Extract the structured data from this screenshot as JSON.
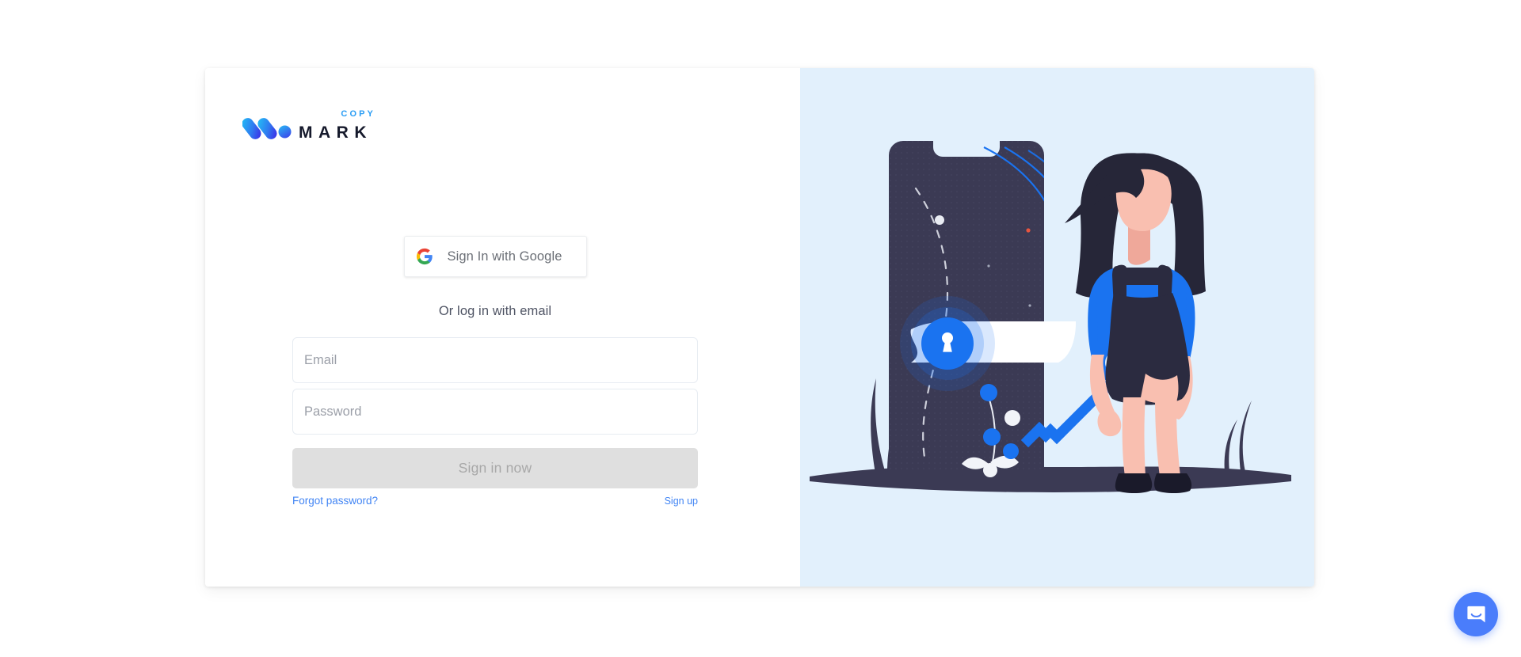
{
  "brand": {
    "mark_text": "MARK",
    "copy_text": "COPY",
    "logo_icon": "markcopy-logo-icon",
    "colors": {
      "copy_blue": "#2a9df4",
      "mark_dark": "#15192b",
      "logo_gradient_start": "#22b8f5",
      "logo_gradient_end": "#3b36e8"
    }
  },
  "auth": {
    "google_button": {
      "label": "Sign In with Google",
      "icon": "google-g-icon"
    },
    "divider_label": "Or log in with email",
    "email": {
      "placeholder": "Email",
      "value": ""
    },
    "password": {
      "placeholder": "Password",
      "value": ""
    },
    "submit_label": "Sign in now",
    "submit_disabled": true,
    "forgot_password_label": "Forgot password?",
    "signup_label": "Sign up",
    "link_color": "#4285f4"
  },
  "illustration": {
    "name": "woman-with-key-and-phone-lock-illustration",
    "background_color": "#e2f0fc",
    "phone_color": "#3b3a54",
    "key_color": "#1a73f0",
    "lock_icon": "keyhole-icon",
    "skin_color": "#f9bfb0",
    "hair_color": "#262638",
    "shirt_color": "#1a73f0",
    "dress_color": "#2b2b40"
  },
  "chat": {
    "launcher_icon": "chat-bubble-icon",
    "launcher_color": "#4a7dfb"
  }
}
